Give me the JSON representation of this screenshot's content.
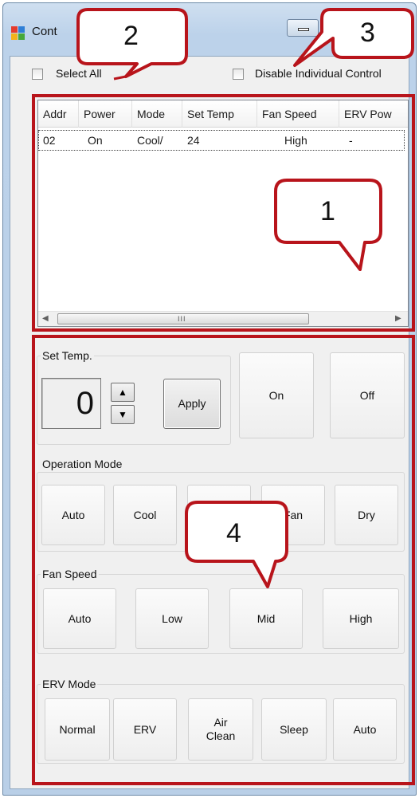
{
  "window": {
    "title": "Cont"
  },
  "top_bar": {
    "select_all_label": "Select All",
    "disable_individual_label": "Disable Individual Control"
  },
  "table": {
    "headers": [
      "Addr",
      "Power",
      "Mode",
      "Set Temp",
      "Fan Speed",
      "ERV Pow"
    ],
    "rows": [
      {
        "addr": "02",
        "power": "On",
        "mode": "Cool/",
        "set_temp": "24",
        "fan_speed": "High",
        "erv_power": "-"
      }
    ],
    "scroll_grip": "III"
  },
  "set_temp": {
    "title": "Set Temp.",
    "value": "0",
    "up_arrow": "▲",
    "down_arrow": "▼",
    "apply_label": "Apply",
    "on_label": "On",
    "off_label": "Off"
  },
  "operation_mode": {
    "title": "Operation Mode",
    "buttons": [
      "Auto",
      "Cool",
      "",
      "Fan",
      "Dry"
    ]
  },
  "fan_speed": {
    "title": "Fan Speed",
    "buttons": [
      "Auto",
      "Low",
      "Mid",
      "High"
    ]
  },
  "erv_mode": {
    "title": "ERV Mode",
    "buttons": [
      "Normal",
      "ERV",
      "Air\nClean",
      "Sleep",
      "Auto"
    ]
  },
  "callouts": [
    "1",
    "2",
    "3",
    "4"
  ],
  "colors": {
    "annotation_red": "#b8141b",
    "window_frame": "#bcd2ea",
    "client_bg": "#f0f0f0"
  }
}
